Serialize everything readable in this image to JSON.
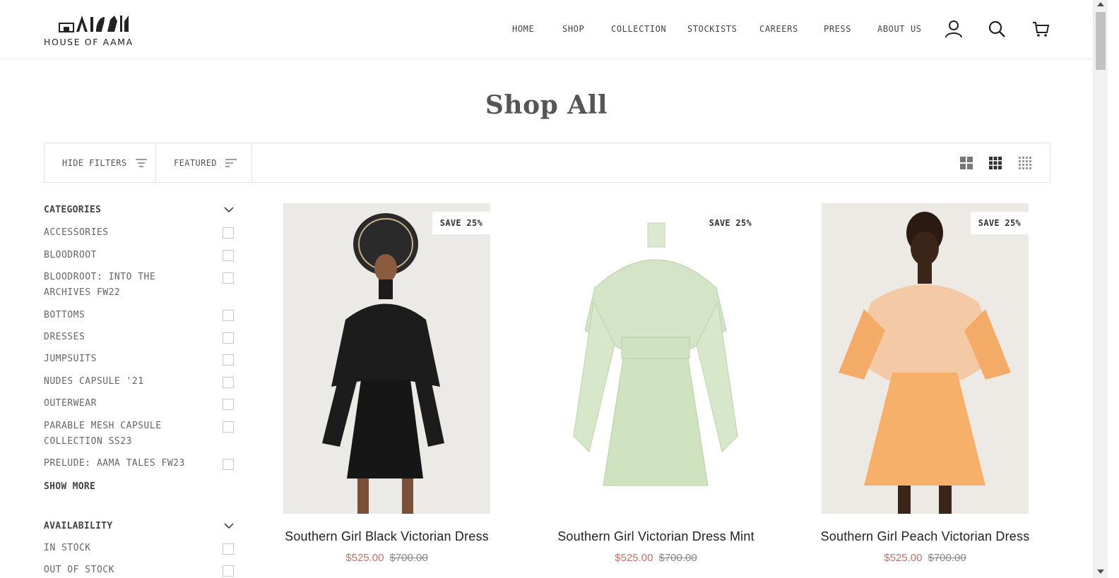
{
  "brand": {
    "logo_text": "HOUSE OF AAMA"
  },
  "nav": {
    "items": [
      "HOME",
      "SHOP",
      "COLLECTION",
      "STOCKISTS",
      "CAREERS",
      "PRESS",
      "ABOUT US"
    ],
    "icons": [
      "account-icon",
      "search-icon",
      "cart-icon"
    ]
  },
  "page": {
    "title": "Shop All"
  },
  "toolbar": {
    "hide_filters": "HIDE FILTERS",
    "sort": "FEATURED",
    "grid_options": [
      "grid-2-icon",
      "grid-3-icon",
      "grid-4-icon"
    ]
  },
  "filters": {
    "categories": {
      "heading": "CATEGORIES",
      "options": [
        "ACCESSORIES",
        "BLOODROOT",
        "BLOODROOT: INTO THE ARCHIVES FW22",
        "BOTTOMS",
        "DRESSES",
        "JUMPSUITS",
        "NUDES CAPSULE '21",
        "OUTERWEAR",
        "PARABLE MESH CAPSULE COLLECTION SS23",
        "PRELUDE: AAMA TALES FW23"
      ],
      "show_more": "SHOW MORE"
    },
    "availability": {
      "heading": "AVAILABILITY",
      "options": [
        "IN STOCK",
        "OUT OF STOCK"
      ]
    }
  },
  "products": [
    {
      "badge": "SAVE 25%",
      "name": "Southern Girl Black Victorian Dress",
      "sale_price": "$525.00",
      "original_price": "$700.00",
      "color": "#1c1c1c"
    },
    {
      "badge": "SAVE 25%",
      "name": "Southern Girl Victorian Dress Mint",
      "sale_price": "$525.00",
      "original_price": "$700.00",
      "color": "#cfe3c3"
    },
    {
      "badge": "SAVE 25%",
      "name": "Southern Girl Peach Victorian Dress",
      "sale_price": "$525.00",
      "original_price": "$700.00",
      "color": "#f6b06a"
    }
  ],
  "colors": {
    "accent_price": "#c4736a",
    "border": "#e3e3e3"
  }
}
